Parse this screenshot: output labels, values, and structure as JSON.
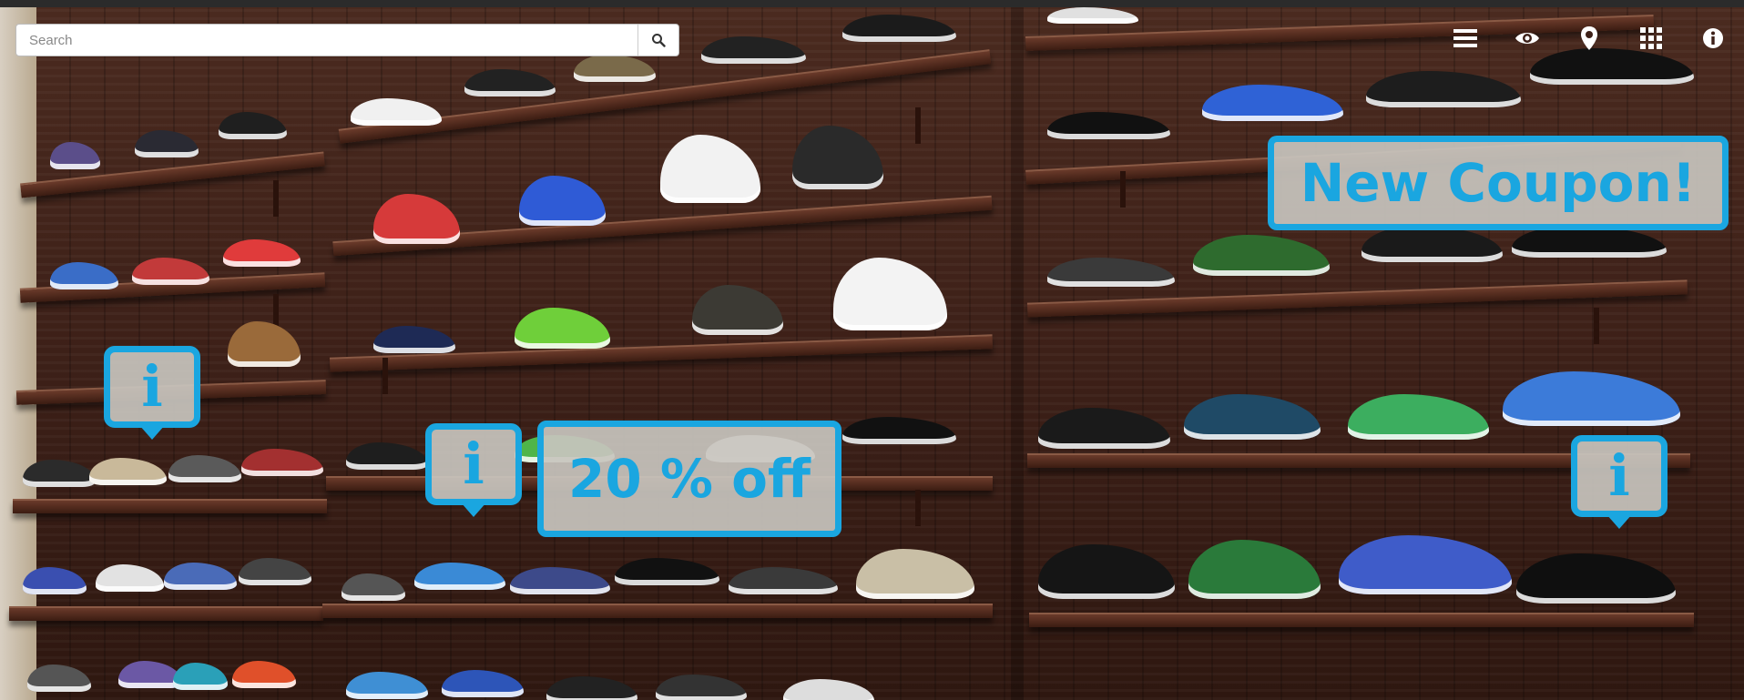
{
  "search": {
    "placeholder": "Search",
    "value": ""
  },
  "toolbar": {
    "items": [
      {
        "icon": "list-icon"
      },
      {
        "icon": "eye-icon"
      },
      {
        "icon": "map-pin-icon"
      },
      {
        "icon": "grid-icon"
      },
      {
        "icon": "info-icon"
      }
    ]
  },
  "hotspots": {
    "left": {
      "glyph": "i"
    },
    "center": {
      "glyph": "i",
      "label": "20 % off"
    },
    "right": {
      "glyph": "i"
    }
  },
  "coupon": {
    "label": "New Coupon!"
  },
  "colors": {
    "accent": "#1aa6e0",
    "wall": "#3d2018",
    "badge_bg": "#c8c4be"
  }
}
